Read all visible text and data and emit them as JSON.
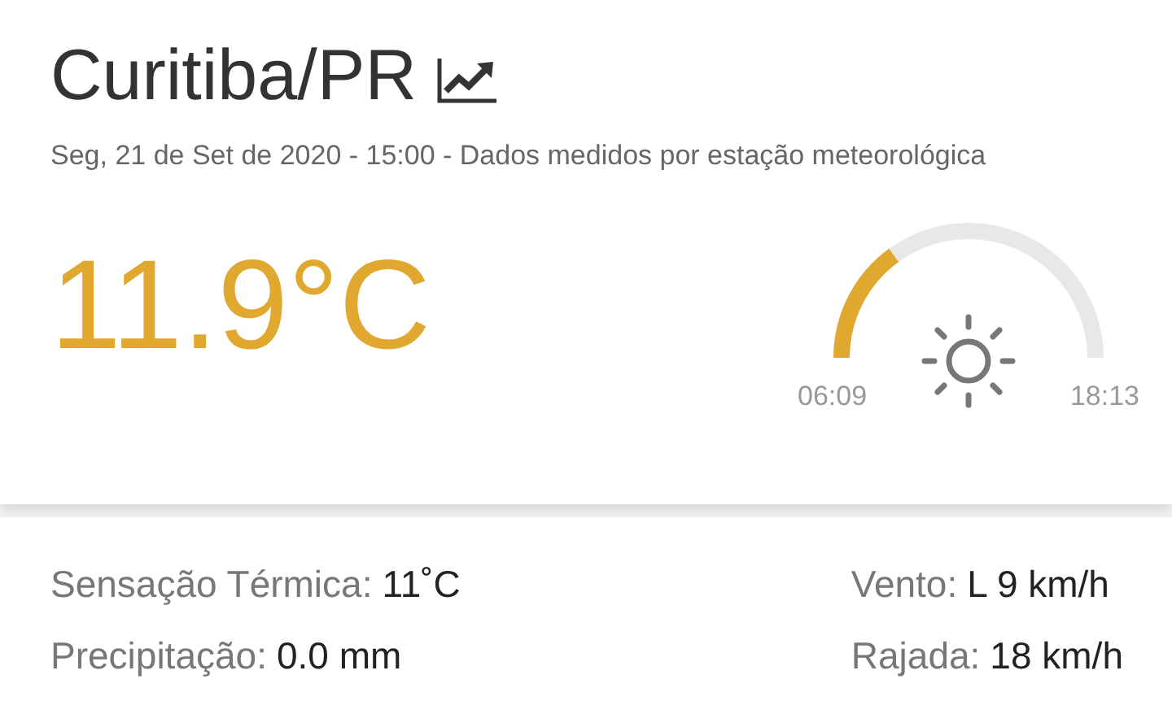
{
  "title": "Curitiba/PR",
  "subtitle": "Seg, 21 de Set de 2020 - 15:00 - Dados medidos por estação meteorológica",
  "temperature": "11.9°C",
  "sun": {
    "sunrise": "06:09",
    "sunset": "18:13"
  },
  "details": [
    {
      "label": "Sensação Térmica:",
      "value": "11˚C"
    },
    {
      "label": "Vento:",
      "value": "L 9 km/h"
    },
    {
      "label": "Precipitação:",
      "value": "0.0 mm"
    },
    {
      "label": "Rajada:",
      "value": "18 km/h"
    }
  ]
}
